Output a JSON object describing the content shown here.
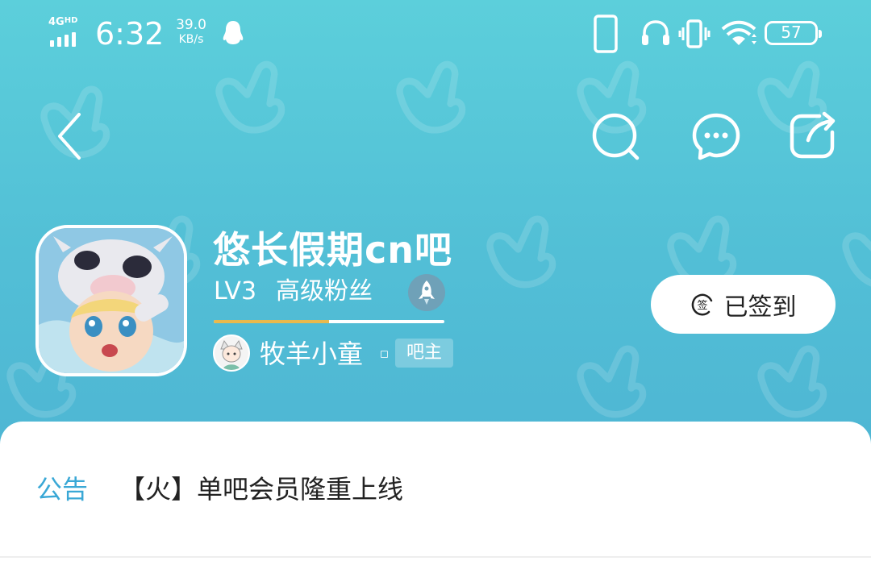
{
  "status_bar": {
    "network": "4G",
    "network_hd": "HD",
    "time": "6:32",
    "speed_value": "39.0",
    "speed_unit": "KB/s",
    "battery": "57"
  },
  "forum": {
    "name": "悠长假期cn吧",
    "level": "LV3",
    "level_title": "高级粉丝",
    "level_progress": 0.5,
    "owner_name": "牧羊小童",
    "owner_badge": "吧主",
    "sign_button": "已签到",
    "sign_icon_char": "签"
  },
  "notice": {
    "label": "公告",
    "text": "【火】单吧会员隆重上线"
  },
  "colors": {
    "header_top": "#5ccfdb",
    "header_bottom": "#4cb1d2",
    "accent_blue": "#3aa8d6",
    "progress_fill": "#e9b94d"
  }
}
